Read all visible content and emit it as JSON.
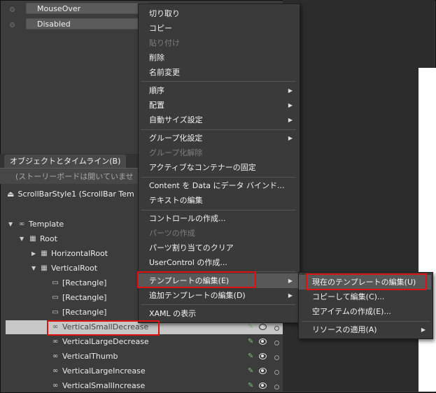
{
  "states": [
    {
      "label": "MouseOver"
    },
    {
      "label": "Disabled"
    }
  ],
  "objects_panel": {
    "tab_label": "オブジェクトとタイムライン(B)",
    "storyboard_text": "(ストーリーボードは開いていませ",
    "scope_label": "ScrollBarStyle1 (ScrollBar Tem"
  },
  "tree": [
    {
      "label": "Template",
      "icon": "template-icon"
    },
    {
      "label": "Root",
      "icon": "grid-icon"
    },
    {
      "label": "HorizontalRoot",
      "icon": "grid-icon"
    },
    {
      "label": "VerticalRoot",
      "icon": "grid-icon"
    },
    {
      "label": "[Rectangle]",
      "icon": "rectangle-icon"
    },
    {
      "label": "[Rectangle]",
      "icon": "rectangle-icon"
    },
    {
      "label": "[Rectangle]",
      "icon": "rectangle-icon"
    },
    {
      "label": "VerticalSmallDecrease",
      "icon": "repeat-button-icon"
    },
    {
      "label": "VerticalLargeDecrease",
      "icon": "repeat-button-icon"
    },
    {
      "label": "VerticalThumb",
      "icon": "thumb-icon"
    },
    {
      "label": "VerticalLargeIncrease",
      "icon": "repeat-button-icon"
    },
    {
      "label": "VerticalSmallIncrease",
      "icon": "repeat-button-icon"
    }
  ],
  "context_menu": [
    {
      "label": "切り取り",
      "enabled": true
    },
    {
      "label": "コピー",
      "enabled": true
    },
    {
      "label": "貼り付け",
      "enabled": false
    },
    {
      "label": "削除",
      "enabled": true
    },
    {
      "label": "名前変更",
      "enabled": true
    },
    {
      "label": "順序",
      "enabled": true,
      "submenu": true
    },
    {
      "label": "配置",
      "enabled": true,
      "submenu": true
    },
    {
      "label": "自動サイズ設定",
      "enabled": true,
      "submenu": true
    },
    {
      "label": "グループ化設定",
      "enabled": true,
      "submenu": true
    },
    {
      "label": "グループ化解除",
      "enabled": false
    },
    {
      "label": "アクティブなコンテナーの固定",
      "enabled": true
    },
    {
      "label": "Content を Data にデータ バインド...",
      "enabled": true
    },
    {
      "label": "テキストの編集",
      "enabled": true
    },
    {
      "label": "コントロールの作成...",
      "enabled": true
    },
    {
      "label": "パーツの作成",
      "enabled": false
    },
    {
      "label": "パーツ割り当てのクリア",
      "enabled": true
    },
    {
      "label": "UserControl の作成...",
      "enabled": true
    },
    {
      "label": "テンプレートの編集(E)",
      "enabled": true,
      "submenu": true,
      "highlighted": true
    },
    {
      "label": "追加テンプレートの編集(D)",
      "enabled": true,
      "submenu": true
    },
    {
      "label": "XAML の表示",
      "enabled": true
    }
  ],
  "submenu": [
    {
      "label": "現在のテンプレートの編集(U)",
      "highlighted": true
    },
    {
      "label": "コピーして編集(C)..."
    },
    {
      "label": "空アイテムの作成(E)..."
    },
    {
      "label": "リソースの適用(A)",
      "submenu": true
    }
  ],
  "icons": {
    "submenu_arrow": "submenu-arrow-icon",
    "expand_arrow": "expand-arrow-icon",
    "visibility": "eye-icon",
    "brush": "brush-icon",
    "lock": "lock-dot-icon",
    "up": "scope-up-icon"
  },
  "colors": {
    "highlight_box": "#dd1111",
    "selected_row": "#c7c7c7",
    "menu_bg": "#3a3a3a",
    "menu_highlight": "#585858"
  }
}
